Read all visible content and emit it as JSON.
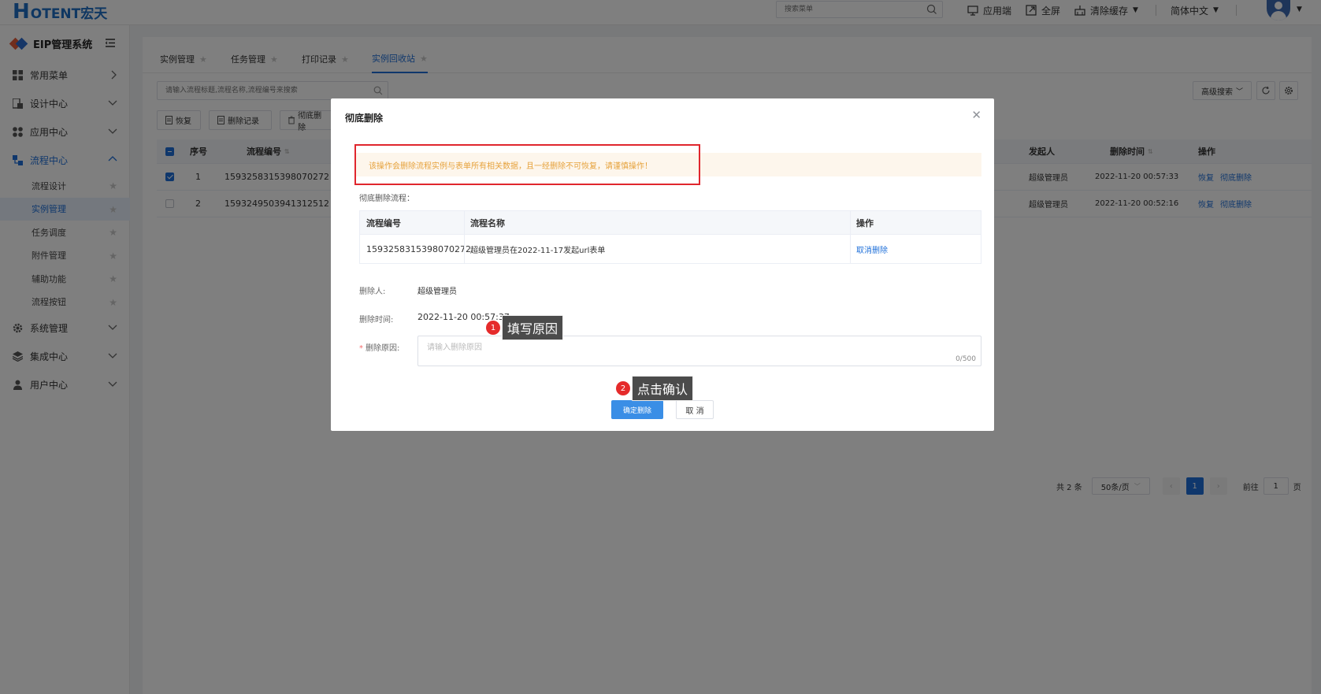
{
  "header": {
    "logo_text": "OTENT宏天",
    "logo_letter": "H",
    "search_placeholder": "搜索菜单",
    "actions": {
      "app_end": "应用端",
      "fullscreen": "全屏",
      "clear_cache": "清除缓存",
      "language": "简体中文"
    }
  },
  "sidebar": {
    "system_title": "EIP管理系统",
    "items": [
      {
        "label": "常用菜单"
      },
      {
        "label": "设计中心"
      },
      {
        "label": "应用中心"
      },
      {
        "label": "流程中心"
      }
    ],
    "sub_items": [
      {
        "label": "流程设计"
      },
      {
        "label": "实例管理"
      },
      {
        "label": "任务调度"
      },
      {
        "label": "附件管理"
      },
      {
        "label": "辅助功能"
      },
      {
        "label": "流程按钮"
      }
    ],
    "bottom_items": [
      {
        "label": "系统管理"
      },
      {
        "label": "集成中心"
      },
      {
        "label": "用户中心"
      }
    ]
  },
  "tabs": [
    {
      "label": "实例管理"
    },
    {
      "label": "任务管理"
    },
    {
      "label": "打印记录"
    },
    {
      "label": "实例回收站"
    }
  ],
  "list": {
    "search_placeholder": "请输入流程标题,流程名称,流程编号来搜索",
    "advanced_search": "高级搜索",
    "toolbar": {
      "restore": "恢复",
      "delete_record": "删除记录",
      "purge": "彻底删除"
    },
    "columns": {
      "index": "序号",
      "process_no": "流程编号",
      "initiator": "发起人",
      "delete_time": "删除时间",
      "action": "操作"
    },
    "rows": [
      {
        "index": "1",
        "process_no": "1593258315398070272",
        "initiator": "超级管理员",
        "delete_time": "2022-11-20 00:57:33",
        "restore": "恢复",
        "purge": "彻底删除"
      },
      {
        "index": "2",
        "process_no": "1593249503941312512",
        "initiator": "超级管理员",
        "delete_time": "2022-11-20 00:52:16",
        "restore": "恢复",
        "purge": "彻底删除"
      }
    ],
    "pager": {
      "total": "共 2 条",
      "page_size": "50条/页",
      "current_page": "1",
      "goto_prefix": "前往",
      "goto_value": "1",
      "goto_suffix": "页"
    }
  },
  "dialog": {
    "title": "彻底删除",
    "warning": "该操作会删除流程实例与表单所有相关数据，且一经删除不可恢复，请谨慎操作！",
    "sub_title": "彻底删除流程：",
    "table": {
      "columns": {
        "process_no": "流程编号",
        "process_name": "流程名称",
        "action": "操作"
      },
      "row": {
        "process_no": "1593258315398070272",
        "process_name": "超级管理员在2022-11-17发起url表单",
        "action": "取消删除"
      }
    },
    "deleter_label": "删除人:",
    "deleter_value": "超级管理员",
    "delete_time_label": "删除时间:",
    "delete_time_value": "2022-11-20 00:57:37",
    "reason_label": "删除原因:",
    "reason_placeholder": "请输入删除原因",
    "reason_count": "0/500",
    "confirm_button": "确定删除",
    "cancel_button": "取 消"
  },
  "callouts": [
    {
      "number": "1",
      "text": "填写原因"
    },
    {
      "number": "2",
      "text": "点击确认"
    }
  ],
  "colors": {
    "primary": "#1e6fd9",
    "warning_text": "#e6a23c",
    "warning_bg": "#fdf6ec",
    "highlight_border": "#e0262d",
    "callout_badge": "#e52b2b"
  }
}
